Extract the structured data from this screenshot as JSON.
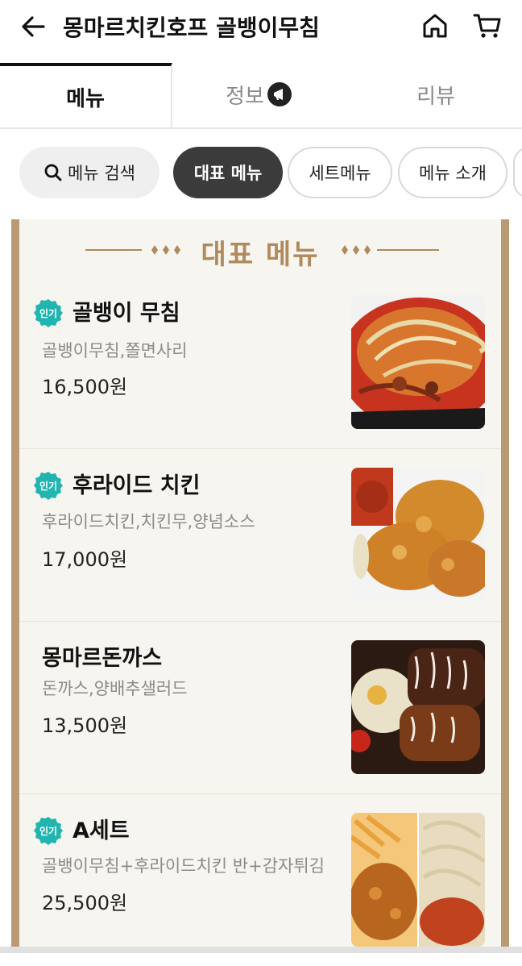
{
  "header": {
    "title": "몽마르치킨호프 골뱅이무침",
    "back_icon": "arrow-left-icon",
    "home_icon": "home-icon",
    "cart_icon": "cart-icon"
  },
  "tabs": [
    {
      "label": "메뉴",
      "active": true
    },
    {
      "label": "정보",
      "icon": "megaphone-icon"
    },
    {
      "label": "리뷰"
    }
  ],
  "chips": {
    "search": "메뉴 검색",
    "items": [
      "대표 메뉴",
      "세트메뉴",
      "메뉴 소개"
    ]
  },
  "section": {
    "title": "대표 메뉴"
  },
  "popular_badge": "인기",
  "menu_items": [
    {
      "name": "골뱅이 무침",
      "desc": "골뱅이무침,쫄면사리",
      "price": "16,500원",
      "popular": true
    },
    {
      "name": "후라이드 치킨",
      "desc": "후라이드치킨,치킨무,양념소스",
      "price": "17,000원",
      "popular": true
    },
    {
      "name": "몽마르돈까스",
      "desc": "돈까스,양배추샐러드",
      "price": "13,500원",
      "popular": false
    },
    {
      "name": "A세트",
      "desc": "골뱅이무침+후라이드치킨 반+감자튀김",
      "price": "25,500원",
      "popular": true
    }
  ],
  "colors": {
    "accent_gold": "#b08a5c",
    "badge_teal": "#22b5b0",
    "chip_active": "#3b3b3b",
    "panel_border": "#b99a74"
  }
}
